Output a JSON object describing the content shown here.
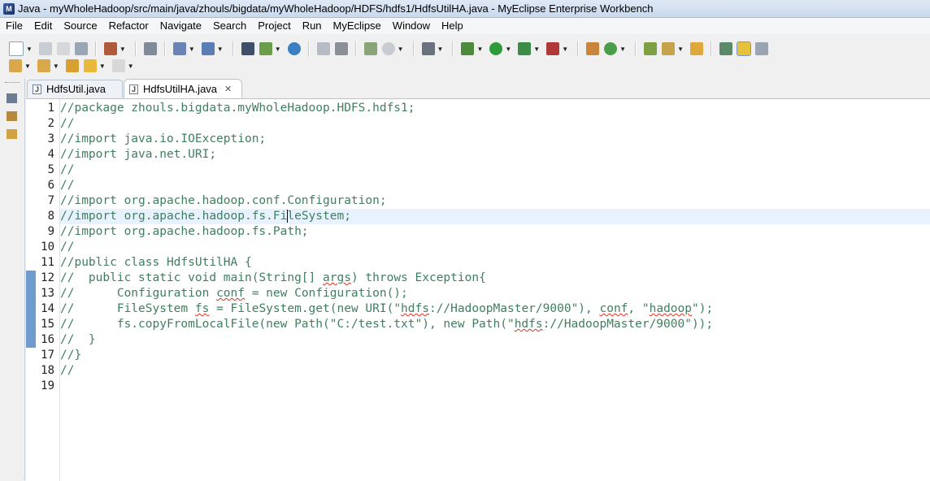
{
  "window": {
    "title": "Java - myWholeHadoop/src/main/java/zhouls/bigdata/myWholeHadoop/HDFS/hdfs1/HdfsUtilHA.java - MyEclipse Enterprise Workbench"
  },
  "menu": [
    "File",
    "Edit",
    "Source",
    "Refactor",
    "Navigate",
    "Search",
    "Project",
    "Run",
    "MyEclipse",
    "Window",
    "Help"
  ],
  "tabs": [
    {
      "label": "HdfsUtil.java",
      "active": false
    },
    {
      "label": "HdfsUtilHA.java",
      "active": true
    }
  ],
  "icons": {
    "close": "✕",
    "dropdown": "▼"
  },
  "colors": {
    "comment": "#3f7f5f",
    "change_marker": "#6f9ccf",
    "current_line": "#e8f2fe"
  },
  "editor": {
    "current_line": 8,
    "lines": [
      {
        "n": "1",
        "text": "//package zhouls.bigdata.myWholeHadoop.HDFS.hdfs1;"
      },
      {
        "n": "2",
        "text": "//"
      },
      {
        "n": "3",
        "text": "//import java.io.IOException;"
      },
      {
        "n": "4",
        "text": "//import java.net.URI;"
      },
      {
        "n": "5",
        "text": "//"
      },
      {
        "n": "6",
        "text": "//"
      },
      {
        "n": "7",
        "text": "//import org.apache.hadoop.conf.Configuration;"
      },
      {
        "n": "8",
        "text_before_caret": "//import org.apache.hadoop.fs.Fi",
        "text_after_caret": "leSystem;"
      },
      {
        "n": "9",
        "text": "//import org.apache.hadoop.fs.Path;"
      },
      {
        "n": "10",
        "text": "//"
      },
      {
        "n": "11",
        "text": "//public class HdfsUtilHA {"
      },
      {
        "n": "12",
        "parts": [
          "//  public static void main(String[] ",
          "args",
          ") throws Exception{"
        ]
      },
      {
        "n": "13",
        "parts": [
          "//      Configuration ",
          "conf",
          " = new Configuration();"
        ]
      },
      {
        "n": "14",
        "parts": [
          "//      FileSystem ",
          "fs",
          " = FileSystem.get(new URI(\"",
          "hdfs",
          "://HadoopMaster/9000\"), ",
          "conf",
          ", \"",
          "hadoop",
          "\");"
        ]
      },
      {
        "n": "15",
        "parts": [
          "//      fs.copyFromLocalFile(new Path(\"C:/test.txt\"), new Path(\"",
          "hdfs",
          "://HadoopMaster/9000\"));"
        ]
      },
      {
        "n": "16",
        "text": "//  }"
      },
      {
        "n": "17",
        "text": "//}"
      },
      {
        "n": "18",
        "text": "//"
      },
      {
        "n": "19",
        "text": ""
      }
    ]
  }
}
